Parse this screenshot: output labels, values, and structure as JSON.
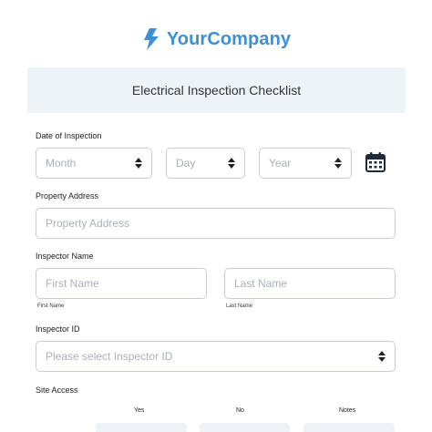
{
  "brand": {
    "name": "YourCompany",
    "icon": "lightning-bolt-icon",
    "color": "#3d8fd6"
  },
  "form": {
    "title": "Electrical Inspection Checklist"
  },
  "date_of_inspection": {
    "label": "Date of Inspection",
    "month_placeholder": "Month",
    "day_placeholder": "Day",
    "year_placeholder": "Year",
    "calendar_icon": "calendar-icon"
  },
  "property_address": {
    "label": "Property Address",
    "placeholder": "Property Address"
  },
  "inspector_name": {
    "label": "Inspector Name",
    "first_placeholder": "First Name",
    "last_placeholder": "Last Name",
    "first_sublabel": "First Name",
    "last_sublabel": "Last Name"
  },
  "inspector_id": {
    "label": "Inspector ID",
    "placeholder": "Please select Inspector ID"
  },
  "site_access": {
    "label": "Site Access",
    "columns": [
      "Yes",
      "No",
      "Notes"
    ]
  }
}
